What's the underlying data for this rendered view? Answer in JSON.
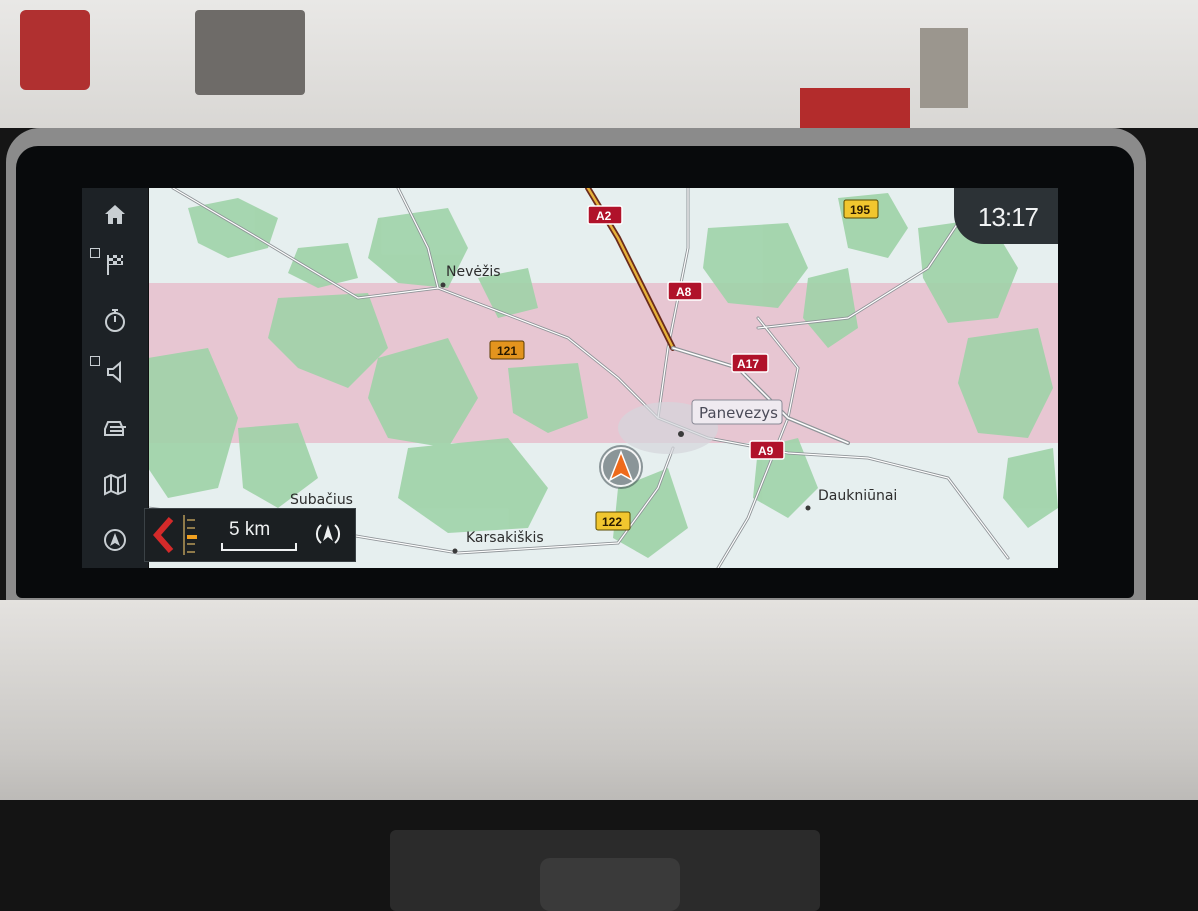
{
  "statusbar": {
    "time": "13:17"
  },
  "sidebar": {
    "items": [
      {
        "icon": "home-icon"
      },
      {
        "icon": "destination-flag-icon"
      },
      {
        "icon": "stopwatch-icon"
      },
      {
        "icon": "speaker-icon"
      },
      {
        "icon": "traffic-car-icon"
      },
      {
        "icon": "map-icon"
      },
      {
        "icon": "navigation-arrow-icon"
      }
    ]
  },
  "map": {
    "places": {
      "nevezis": "Nevėžis",
      "subacius": "Subačius",
      "karsakiskis": "Karsakiškis",
      "dauknunai": "Daukniūnai",
      "panevezys": "Panevezys"
    },
    "road_shields": {
      "a2": "A2",
      "a8": "A8",
      "a17": "A17",
      "a9": "A9",
      "r121": "121",
      "r122": "122",
      "r195": "195"
    }
  },
  "scale": {
    "label": "5 km"
  },
  "colors": {
    "motorway": "#b0122a",
    "regional": "#e3941e",
    "local": "#f1c62f",
    "forest": "#9fd3a8",
    "map_bg": "#e3ecec"
  }
}
